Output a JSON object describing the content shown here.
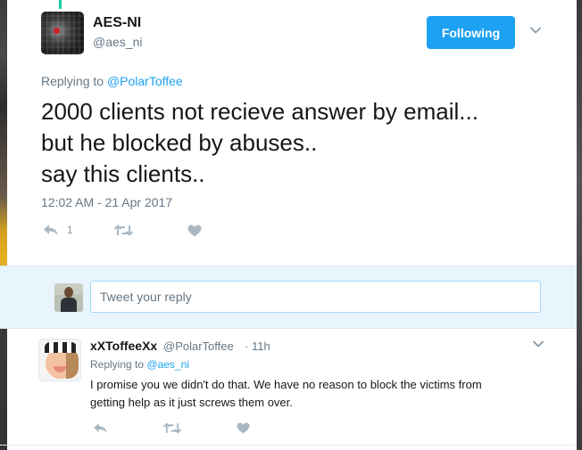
{
  "tweet": {
    "display_name": "AES-NI",
    "handle": "@aes_ni",
    "follow_label": "Following",
    "replying_prefix": "Replying to",
    "replying_to": "@PolarToffee",
    "text_lines": [
      "2000 clients not recieve answer by email...",
      "but he blocked by abuses..",
      "say this clients.."
    ],
    "timestamp": "12:02 AM - 21 Apr 2017",
    "reply_count": "1"
  },
  "reply_box": {
    "placeholder": "Tweet your reply"
  },
  "reply_tweet": {
    "display_name": "xXToffeeXx",
    "handle": "@PolarToffee",
    "separator": "·",
    "time": "11h",
    "replying_prefix": "Replying to",
    "replying_to": "@aes_ni",
    "text_lines": [
      "I promise you we didn't do that. We have no reason to block the victims from",
      "getting help as it just screws them over."
    ]
  },
  "icons": {
    "reply": "reply-icon",
    "retweet": "retweet-icon",
    "like": "heart-icon",
    "more": "chevron-down-icon"
  },
  "colors": {
    "accent": "#1da1f2",
    "muted": "#657786",
    "reply_bar_bg": "#e8f5fd"
  }
}
